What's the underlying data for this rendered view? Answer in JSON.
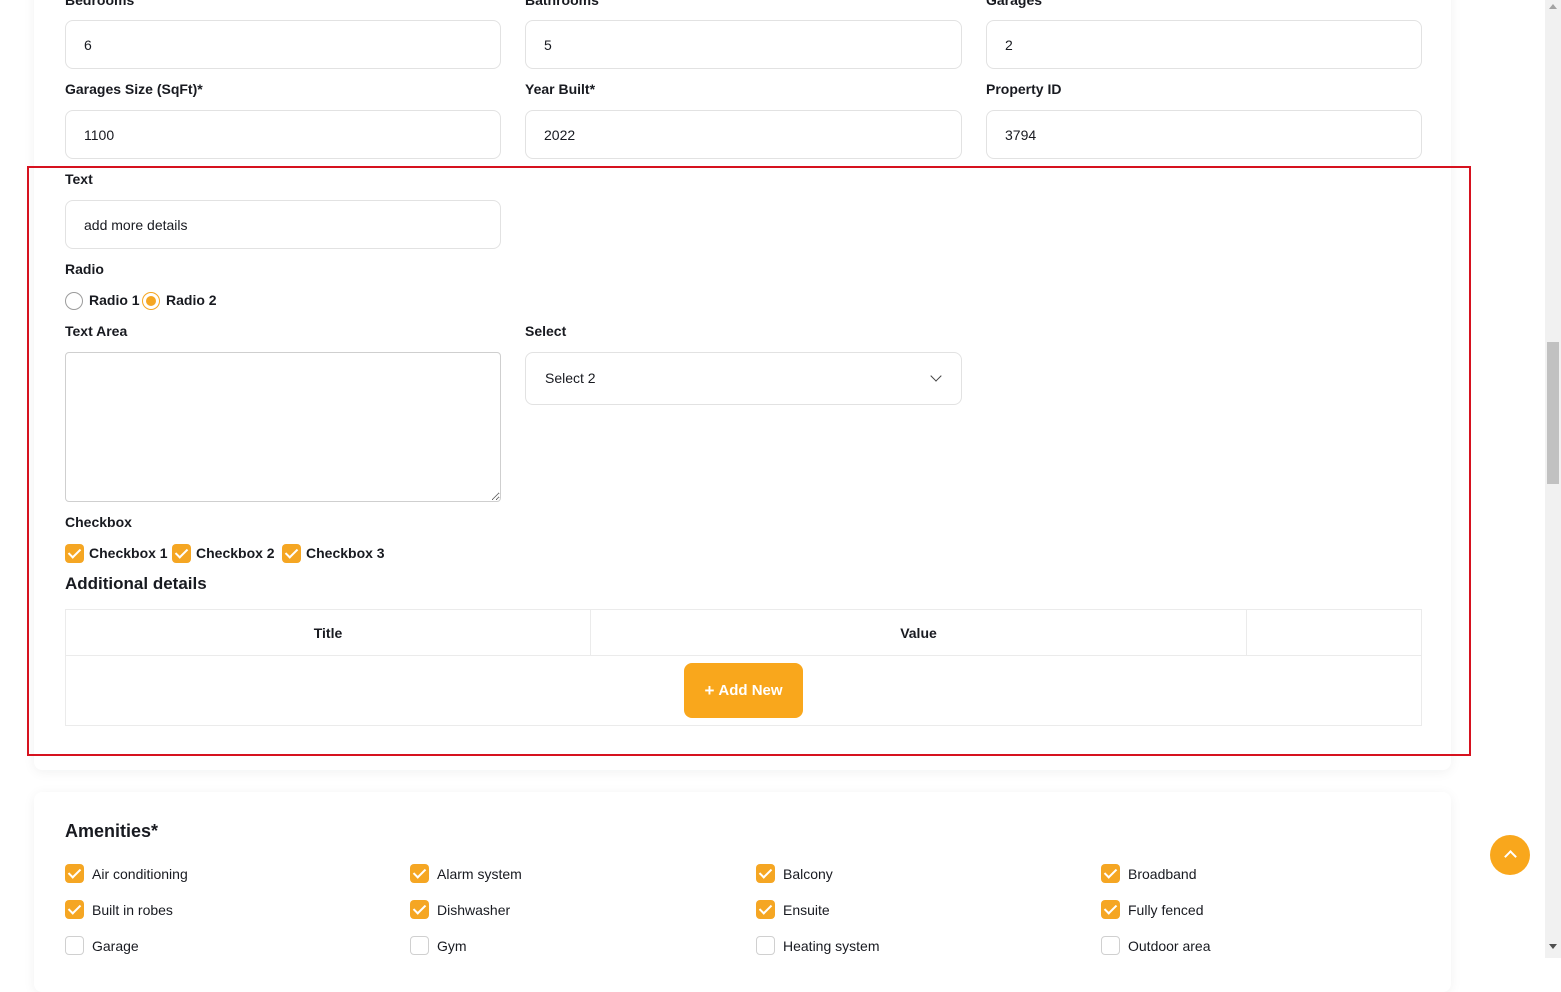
{
  "top_fields": {
    "bedrooms": {
      "label": "Bedrooms",
      "value": "6"
    },
    "bathrooms": {
      "label": "Bathrooms",
      "value": "5"
    },
    "garages": {
      "label": "Garages",
      "value": "2"
    },
    "garage_size": {
      "label": "Garages Size (SqFt)*",
      "value": "1100"
    },
    "year_built": {
      "label": "Year Built*",
      "value": "2022"
    },
    "property_id": {
      "label": "Property ID",
      "value": "3794"
    }
  },
  "custom_fields": {
    "text": {
      "label": "Text",
      "value": "add more details"
    },
    "radio": {
      "label": "Radio",
      "options": [
        "Radio 1",
        "Radio 2"
      ],
      "selected": "Radio 2"
    },
    "textarea": {
      "label": "Text Area",
      "value": ""
    },
    "select": {
      "label": "Select",
      "value": "Select 2"
    },
    "checkbox": {
      "label": "Checkbox",
      "options": [
        "Checkbox 1",
        "Checkbox 2",
        "Checkbox 3"
      ],
      "checked": [
        true,
        true,
        true
      ]
    }
  },
  "additional_details": {
    "heading": "Additional details",
    "columns": [
      "Title",
      "Value",
      ""
    ],
    "add_button": "Add New",
    "add_button_icon": "plus-icon"
  },
  "amenities": {
    "heading": "Amenities*",
    "items": [
      {
        "label": "Air conditioning",
        "checked": true
      },
      {
        "label": "Alarm system",
        "checked": true
      },
      {
        "label": "Balcony",
        "checked": true
      },
      {
        "label": "Broadband",
        "checked": true
      },
      {
        "label": "Built in robes",
        "checked": true
      },
      {
        "label": "Dishwasher",
        "checked": true
      },
      {
        "label": "Ensuite",
        "checked": true
      },
      {
        "label": "Fully fenced",
        "checked": true
      },
      {
        "label": "Garage",
        "checked": false
      },
      {
        "label": "Gym",
        "checked": false
      },
      {
        "label": "Heating system",
        "checked": false
      },
      {
        "label": "Outdoor area",
        "checked": false
      }
    ]
  },
  "scroll_to_top_icon": "chevron-up-icon",
  "colors": {
    "accent": "#f9a71c",
    "highlight": "#d6121f",
    "text": "#181a20",
    "border": "#e2e2e2"
  }
}
